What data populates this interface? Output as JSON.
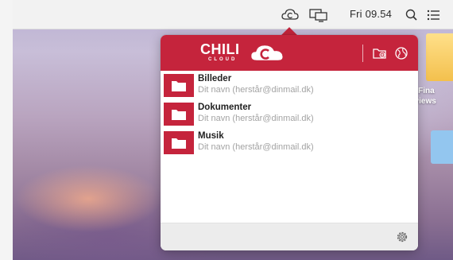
{
  "menubar": {
    "time": "Fri 09.54",
    "icons": [
      "chili-cloud-menubar-icon",
      "display-mirroring-icon",
      "spotlight-search-icon",
      "notification-list-icon"
    ]
  },
  "desktop": {
    "partial_label_line1": "rra Fina",
    "partial_label_line2": "eviews"
  },
  "popover": {
    "logo": {
      "text": "CHILI",
      "subtext": "CLOUD"
    },
    "header_icons": [
      "new-folder-icon",
      "globe-icon"
    ],
    "folders": [
      {
        "name": "Billeder",
        "owner": "Dit navn (herstår@dinmail.dk)"
      },
      {
        "name": "Dokumenter",
        "owner": "Dit navn (herstår@dinmail.dk)"
      },
      {
        "name": "Musik",
        "owner": "Dit navn (herstår@dinmail.dk)"
      }
    ],
    "footer_icon": "gear-icon"
  },
  "colors": {
    "brand_red": "#c5243c",
    "folder_subtext": "#a3a3a3",
    "footer_bg": "#ececec"
  }
}
